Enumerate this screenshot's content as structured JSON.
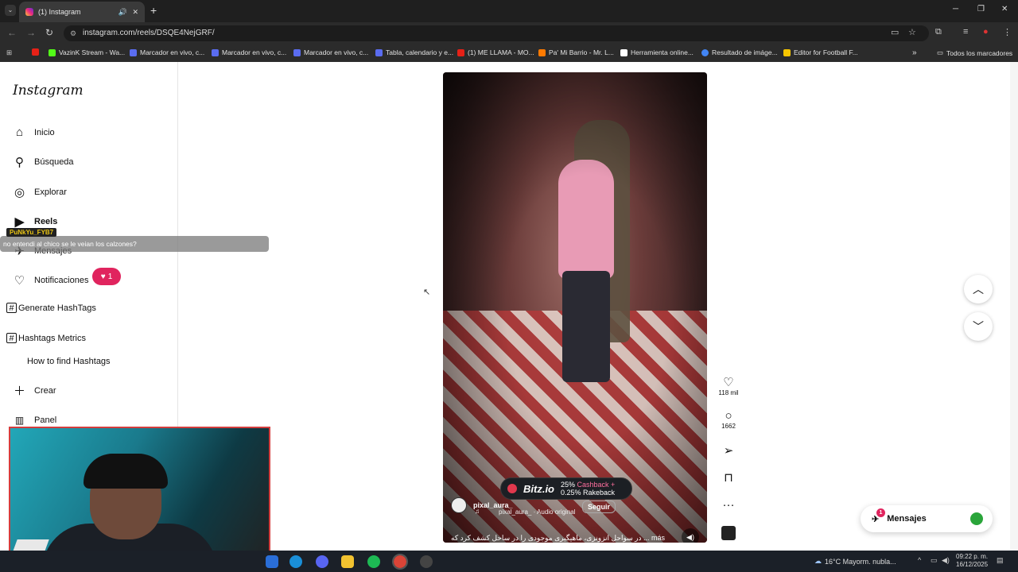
{
  "browser": {
    "tab_title": "(1) Instagram",
    "new_tab": "+",
    "url": "instagram.com/reels/DSQE4NejGRF/",
    "bookmarks": [
      {
        "label": "",
        "color": "#e62117"
      },
      {
        "label": "VazinK Stream - Wa...",
        "color": "#53fc18"
      },
      {
        "label": "Marcador en vivo, c...",
        "color": "#5a6cf0"
      },
      {
        "label": "Marcador en vivo, c...",
        "color": "#5a6cf0"
      },
      {
        "label": "Marcador en vivo, c...",
        "color": "#5a6cf0"
      },
      {
        "label": "Tabla, calendario y e...",
        "color": "#5a6cf0"
      },
      {
        "label": "(1) ME LLAMA - MO...",
        "color": "#e62117"
      },
      {
        "label": "Pa' Mi Barrio - Mr. L...",
        "color": "#ff7a00"
      },
      {
        "label": "Herramienta online...",
        "color": "#ffffff"
      },
      {
        "label": "Resultado de imáge...",
        "color": "#4285f4"
      },
      {
        "label": "Editor for Football F...",
        "color": "#f7c600"
      }
    ],
    "bookmarks_more": "»",
    "all_bookmarks": "Todos los marcadores"
  },
  "sidebar": {
    "logo": "Instagram",
    "items": [
      {
        "label": "Inicio",
        "icon": "home-icon"
      },
      {
        "label": "Búsqueda",
        "icon": "search-icon"
      },
      {
        "label": "Explorar",
        "icon": "compass-icon"
      },
      {
        "label": "Reels",
        "icon": "reels-icon"
      },
      {
        "label": "Mensajes",
        "icon": "messenger-icon"
      },
      {
        "label": "Notificaciones",
        "icon": "heart-icon"
      },
      {
        "label": "Generate HashTags",
        "icon": "hashtag-icon"
      },
      {
        "label": "Hashtags Metrics",
        "icon": "hashtag-icon"
      },
      {
        "label": "How to find Hashtags",
        "icon": ""
      },
      {
        "label": "Crear",
        "icon": "plus-icon"
      },
      {
        "label": "Panel",
        "icon": "chart-icon"
      }
    ],
    "notif_count": "1"
  },
  "stream_overlay": {
    "chat_user": "PuNkYu_FYB7",
    "chat_message": "no entendi al chico se le veian los calzones?"
  },
  "reel": {
    "ad_brand": "Bitz.io",
    "ad_line1_a": "25% ",
    "ad_line1_b": "Cashback +",
    "ad_line2": "0.25% Rakeback",
    "username": "pixal_aura_",
    "audio": "pixal_aura_ · Audio original",
    "follow": "Seguir",
    "caption": "در سواحل انزونزی، ماهیگیری موجودی را در ساحل کشف کرد که ... más",
    "likes": "118 mil",
    "comments": "1662"
  },
  "messages_pill": {
    "label": "Mensajes",
    "count": "1"
  },
  "taskbar": {
    "weather": "16°C  Mayorm. nubla...",
    "time": "09:22 p. m.",
    "date": "16/12/2025"
  }
}
